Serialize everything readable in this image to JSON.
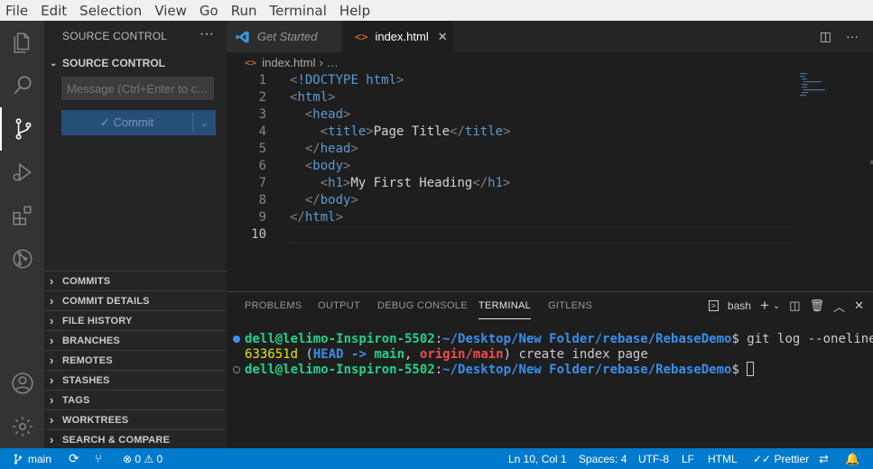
{
  "menu": [
    "File",
    "Edit",
    "Selection",
    "View",
    "Go",
    "Run",
    "Terminal",
    "Help"
  ],
  "sidebar": {
    "title": "SOURCE CONTROL",
    "more": "···",
    "section": "SOURCE CONTROL",
    "message_placeholder": "Message (Ctrl+Enter to c...",
    "commit_label": "✓ Commit",
    "collapsed_sections": [
      "COMMITS",
      "COMMIT DETAILS",
      "FILE HISTORY",
      "BRANCHES",
      "REMOTES",
      "STASHES",
      "TAGS",
      "WORKTREES",
      "SEARCH & COMPARE"
    ]
  },
  "tabs": [
    {
      "label": "Get Started"
    },
    {
      "label": "index.html"
    }
  ],
  "breadcrumb": {
    "file": "index.html",
    "rest": "…"
  },
  "editor": {
    "lines": [
      {
        "n": "1",
        "indent": "",
        "open": "<!DOCTYPE html>",
        "text": "",
        "close": ""
      },
      {
        "n": "2",
        "indent": "",
        "open": "<html>",
        "text": "",
        "close": ""
      },
      {
        "n": "3",
        "indent": "  ",
        "open": "<head>",
        "text": "",
        "close": ""
      },
      {
        "n": "4",
        "indent": "    ",
        "open": "<title>",
        "text": "Page Title",
        "close": "</title>"
      },
      {
        "n": "5",
        "indent": "  ",
        "open": "</head>",
        "text": "",
        "close": ""
      },
      {
        "n": "6",
        "indent": "  ",
        "open": "<body>",
        "text": "",
        "close": ""
      },
      {
        "n": "7",
        "indent": "    ",
        "open": "<h1>",
        "text": "My First Heading",
        "close": "</h1>"
      },
      {
        "n": "8",
        "indent": "  ",
        "open": "</body>",
        "text": "",
        "close": ""
      },
      {
        "n": "9",
        "indent": "",
        "open": "</html>",
        "text": "",
        "close": ""
      },
      {
        "n": "10",
        "indent": "",
        "open": "",
        "text": "",
        "close": ""
      }
    ]
  },
  "panel": {
    "tabs": [
      "PROBLEMS",
      "OUTPUT",
      "DEBUG CONSOLE",
      "TERMINAL",
      "GITLENS"
    ],
    "active_tab": "TERMINAL",
    "shell": "bash",
    "terminal": {
      "line1": {
        "user": "dell@lelimo-Inspiron-5502",
        "path": "~/Desktop/New Folder/rebase/RebaseDemo",
        "cmd": "$ git log --oneline"
      },
      "line2": {
        "hash": "633651d",
        "open": " (",
        "head": "HEAD -> ",
        "main": "main",
        "comma": ", ",
        "origin": "origin/main",
        "rest": ") create index page"
      },
      "line3": {
        "user": "dell@lelimo-Inspiron-5502",
        "path": "~/Desktop/New Folder/rebase/RebaseDemo",
        "cmd": "$ "
      }
    }
  },
  "status": {
    "branch": "main",
    "problems": "⊗ 0 ⚠ 0",
    "position": "Ln 10, Col 1",
    "spaces": "Spaces: 4",
    "encoding": "UTF-8",
    "eol": "LF",
    "language": "HTML",
    "prettier": "✓✓ Prettier"
  },
  "colors": {
    "accent": "#007acc",
    "commit_button": "#264f78"
  }
}
